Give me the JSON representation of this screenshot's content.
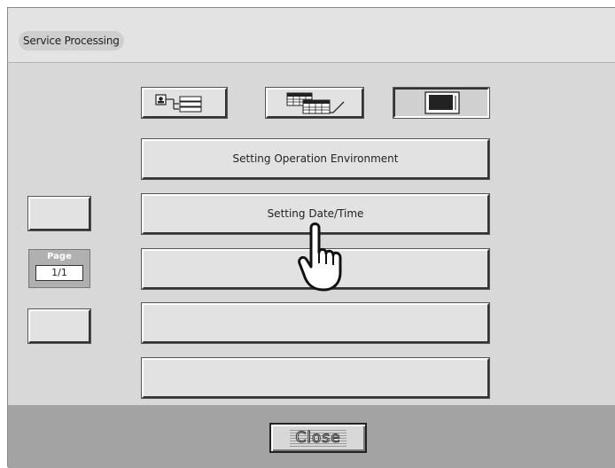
{
  "window": {
    "title": "Service Processing"
  },
  "icon_tabs": [
    {
      "icon": "user-list-icon"
    },
    {
      "icon": "calendar-check-icon"
    },
    {
      "icon": "monitor-icon",
      "selected": true
    }
  ],
  "menu": {
    "items": [
      {
        "label": "Setting Operation Environment"
      },
      {
        "label": "Setting Date/Time"
      },
      {
        "label": ""
      },
      {
        "label": ""
      },
      {
        "label": ""
      }
    ]
  },
  "pager": {
    "label": "Page",
    "value": "1/1"
  },
  "footer": {
    "close_label": "Close"
  },
  "colors": {
    "background": "#d8d8d8",
    "header": "#e3e3e3",
    "footer": "#a3a3a3"
  }
}
